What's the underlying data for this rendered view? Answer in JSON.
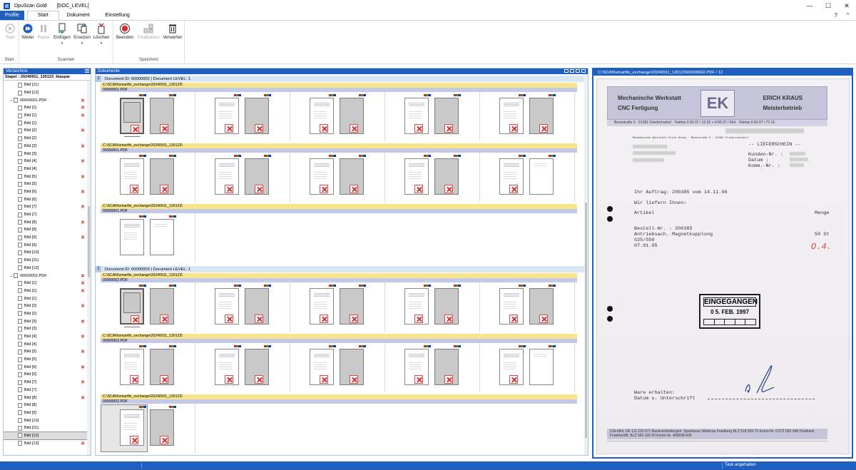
{
  "window": {
    "app_title": "DpuScan Gold",
    "doc_title": "[DOC_LEVEL]",
    "minimize": "—",
    "maximize": "☐",
    "close": "✕"
  },
  "tabs": {
    "profile": "Profile",
    "start": "Start",
    "dokument": "Dokument",
    "einstellung": "Einstellung",
    "help": "?",
    "collapse": "⌃"
  },
  "ribbon": {
    "group_start": "Start",
    "group_scannen": "Scannen",
    "group_speichern": "Speichern",
    "btn_start": "Start",
    "btn_weiter": "Weiter",
    "btn_pause": "Pause",
    "btn_einfuegen": "Einfügen",
    "btn_ersetzen": "Ersetzen",
    "btn_loeschen": "Löschen",
    "btn_beenden": "Beenden",
    "btn_finalisieren": "Finalisieren",
    "btn_verwerfen": "Verwerfen",
    "drop": "▾"
  },
  "left_panel": {
    "title": "Verzeichnis",
    "stapel": "Stapel : 20240911_130123_tkaspar",
    "items": [
      {
        "type": "img",
        "label": "Bild [11]",
        "x": false
      },
      {
        "type": "img",
        "label": "Bild [12]",
        "x": false
      },
      {
        "type": "pdf",
        "label": "00000001.PDF",
        "x": true
      },
      {
        "type": "img",
        "label": "Bild [1]",
        "x": true
      },
      {
        "type": "img",
        "label": "Bild [1]",
        "x": true
      },
      {
        "type": "img",
        "label": "Bild [1]",
        "x": false
      },
      {
        "type": "img",
        "label": "Bild [2]",
        "x": true
      },
      {
        "type": "img",
        "label": "Bild [2]",
        "x": false
      },
      {
        "type": "img",
        "label": "Bild [3]",
        "x": true
      },
      {
        "type": "img",
        "label": "Bild [3]",
        "x": false
      },
      {
        "type": "img",
        "label": "Bild [4]",
        "x": true
      },
      {
        "type": "img",
        "label": "Bild [4]",
        "x": false
      },
      {
        "type": "img",
        "label": "Bild [5]",
        "x": true
      },
      {
        "type": "img",
        "label": "Bild [5]",
        "x": false
      },
      {
        "type": "img",
        "label": "Bild [6]",
        "x": true
      },
      {
        "type": "img",
        "label": "Bild [6]",
        "x": false
      },
      {
        "type": "img",
        "label": "Bild [7]",
        "x": true
      },
      {
        "type": "img",
        "label": "Bild [7]",
        "x": false
      },
      {
        "type": "img",
        "label": "Bild [8]",
        "x": true
      },
      {
        "type": "img",
        "label": "Bild [8]",
        "x": false
      },
      {
        "type": "img",
        "label": "Bild [9]",
        "x": true
      },
      {
        "type": "img",
        "label": "Bild [9]",
        "x": false
      },
      {
        "type": "img",
        "label": "Bild [10]",
        "x": false
      },
      {
        "type": "img",
        "label": "Bild [11]",
        "x": false
      },
      {
        "type": "img",
        "label": "Bild [12]",
        "x": false
      },
      {
        "type": "pdf",
        "label": "00000002.PDF",
        "x": true
      },
      {
        "type": "img",
        "label": "Bild [1]",
        "x": true
      },
      {
        "type": "img",
        "label": "Bild [1]",
        "x": true
      },
      {
        "type": "img",
        "label": "Bild [1]",
        "x": false
      },
      {
        "type": "img",
        "label": "Bild [2]",
        "x": true
      },
      {
        "type": "img",
        "label": "Bild [2]",
        "x": false
      },
      {
        "type": "img",
        "label": "Bild [3]",
        "x": true
      },
      {
        "type": "img",
        "label": "Bild [3]",
        "x": false
      },
      {
        "type": "img",
        "label": "Bild [4]",
        "x": true
      },
      {
        "type": "img",
        "label": "Bild [4]",
        "x": false
      },
      {
        "type": "img",
        "label": "Bild [5]",
        "x": true
      },
      {
        "type": "img",
        "label": "Bild [5]",
        "x": false
      },
      {
        "type": "img",
        "label": "Bild [6]",
        "x": true
      },
      {
        "type": "img",
        "label": "Bild [6]",
        "x": false
      },
      {
        "type": "img",
        "label": "Bild [7]",
        "x": true
      },
      {
        "type": "img",
        "label": "Bild [7]",
        "x": false
      },
      {
        "type": "img",
        "label": "Bild [8]",
        "x": true
      },
      {
        "type": "img",
        "label": "Bild [8]",
        "x": false
      },
      {
        "type": "img",
        "label": "Bild [9]",
        "x": false
      },
      {
        "type": "img",
        "label": "Bild [10]",
        "x": false
      },
      {
        "type": "img",
        "label": "Bild [11]",
        "x": false
      },
      {
        "type": "img",
        "label": "Bild [12]",
        "x": false,
        "selected": true
      },
      {
        "type": "img",
        "label": "Bild [13]",
        "x": true
      }
    ]
  },
  "center_panel": {
    "title": "Dokumente",
    "documents": [
      {
        "header_num": "1",
        "header": "Document ID: 00000002 | Document LEVEL: 1",
        "sections": [
          {
            "path": "C:\\SCAN\\smartfix_exchange\\20240911_130123\\",
            "file": "00000001.PDF",
            "cells": 5,
            "first_dark": true,
            "xmarks": true,
            "last_white": false
          },
          {
            "path": "C:\\SCAN\\smartfix_exchange\\20240911_130123\\",
            "file": "00000001.PDF",
            "cells": 5,
            "first_dark": false,
            "xmarks": true,
            "last_white": true
          },
          {
            "path": "C:\\SCAN\\smartfix_exchange\\20240911_130123\\",
            "file": "00000001.PDF",
            "cells": 1,
            "first_dark": false,
            "xmarks": false,
            "last_white": true
          }
        ]
      },
      {
        "header_num": "1",
        "header": "Document ID: 00000003 | Document LEVEL: 1",
        "sections": [
          {
            "path": "C:\\SCAN\\smartfix_exchange\\20240911_130123\\",
            "file": "00000002.PDF",
            "cells": 5,
            "first_dark": true,
            "xmarks": true,
            "last_white": false
          },
          {
            "path": "C:\\SCAN\\smartfix_exchange\\20240911_130123\\",
            "file": "00000002.PDF",
            "cells": 5,
            "first_dark": false,
            "xmarks": true,
            "last_white": true
          },
          {
            "path": "C:\\SCAN\\smartfix_exchange\\20240911_130123\\",
            "file": "00000002.PDF",
            "cells": 1,
            "first_dark": false,
            "xmarks": true,
            "last_white": false,
            "selected": true
          }
        ]
      }
    ]
  },
  "right_panel": {
    "title": "C:\\SCAN\\smartfix_exchange\\20240911_130123\\00000002.PDF / 12",
    "letterhead": {
      "left1": "Mechanische Werkstatt",
      "left2": "CNC Fertigung",
      "logo": "EK",
      "right1": "ERICH KRAUS",
      "right2": "Meisterbetrieb",
      "address": "Benzstraße 5 · 61381 Friedrichsdorf · Telefon 0 60 07 / 13 92 + 8 60 07 / 564 · Telefax 0 60 07 / 72 16"
    },
    "sender_line": "Mechanische Werkstatt Erich Kraus · Benzstraße 5 · 61381 Friedrichsdorf",
    "lieferschein": "-- LIEFERSCHEIN --",
    "kunden_nr": "Kunden-Nr. :",
    "datum": "Datum     :",
    "komm_nr": "Komm.-Nr. :",
    "auftrag": "Ihr Auftrag: 200385   vom 14.11.96",
    "wir_liefern": "Wir liefern Ihnen:",
    "artikel": "Artikel",
    "menge": "Menge",
    "bestell": "Bestell-Nr. : 200385",
    "antrieb": "Antriebsach. Magnetkupplung",
    "menge_val": "50  St",
    "s25": "S25/S50",
    "date2": "07.01.95",
    "handwritten": "O.4.",
    "stamp_title": "EINGEGANGEN",
    "stamp_date": "0 5. FEB. 1997",
    "ware": "Ware erhalten:",
    "datum_unterschrift": "Datum u. Unterschrift",
    "footer": "USt-IdNr. DE 111 220 671   Bankverbindungen:   Sparkasse Wetterau Friedberg   BLZ 518 500 79   Konto-Nr. 0 072 005 048   Postbank Frankfurt/M.   BLZ 500 100 60   Konto-Nr. 405838-605"
  },
  "status": {
    "text": "Task angehalten"
  }
}
